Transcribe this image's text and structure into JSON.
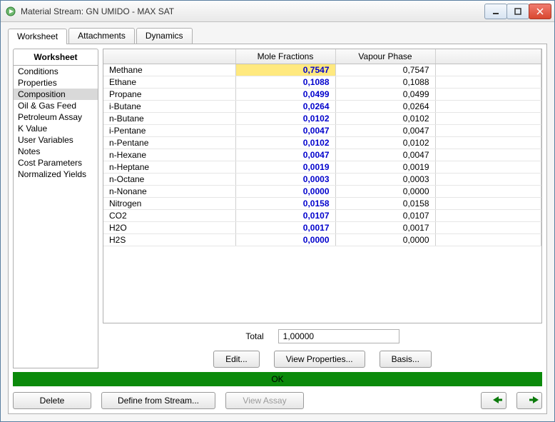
{
  "window": {
    "title": "Material Stream: GN UMIDO - MAX SAT"
  },
  "tabs": {
    "worksheet": "Worksheet",
    "attachments": "Attachments",
    "dynamics": "Dynamics"
  },
  "nav": {
    "header": "Worksheet",
    "items": [
      "Conditions",
      "Properties",
      "Composition",
      "Oil & Gas Feed",
      "Petroleum Assay",
      "K Value",
      "User Variables",
      "Notes",
      "Cost Parameters",
      "Normalized Yields"
    ],
    "selected_index": 2
  },
  "grid": {
    "headers": {
      "name": "",
      "mole_fractions": "Mole Fractions",
      "vapour_phase": "Vapour Phase"
    },
    "rows": [
      {
        "name": "Methane",
        "mf": "0,7547",
        "vp": "0,7547",
        "hl": true
      },
      {
        "name": "Ethane",
        "mf": "0,1088",
        "vp": "0,1088"
      },
      {
        "name": "Propane",
        "mf": "0,0499",
        "vp": "0,0499"
      },
      {
        "name": "i-Butane",
        "mf": "0,0264",
        "vp": "0,0264"
      },
      {
        "name": "n-Butane",
        "mf": "0,0102",
        "vp": "0,0102"
      },
      {
        "name": "i-Pentane",
        "mf": "0,0047",
        "vp": "0,0047"
      },
      {
        "name": "n-Pentane",
        "mf": "0,0102",
        "vp": "0,0102"
      },
      {
        "name": "n-Hexane",
        "mf": "0,0047",
        "vp": "0,0047"
      },
      {
        "name": "n-Heptane",
        "mf": "0,0019",
        "vp": "0,0019"
      },
      {
        "name": "n-Octane",
        "mf": "0,0003",
        "vp": "0,0003"
      },
      {
        "name": "n-Nonane",
        "mf": "0,0000",
        "vp": "0,0000"
      },
      {
        "name": "Nitrogen",
        "mf": "0,0158",
        "vp": "0,0158"
      },
      {
        "name": "CO2",
        "mf": "0,0107",
        "vp": "0,0107"
      },
      {
        "name": "H2O",
        "mf": "0,0017",
        "vp": "0,0017"
      },
      {
        "name": "H2S",
        "mf": "0,0000",
        "vp": "0,0000"
      }
    ]
  },
  "total": {
    "label": "Total",
    "value": "1,00000"
  },
  "buttons": {
    "edit": "Edit...",
    "view_properties": "View Properties...",
    "basis": "Basis...",
    "ok": "OK",
    "delete": "Delete",
    "define": "Define from Stream...",
    "view_assay": "View Assay"
  },
  "arrows": {
    "back": "←",
    "forward": "→"
  }
}
